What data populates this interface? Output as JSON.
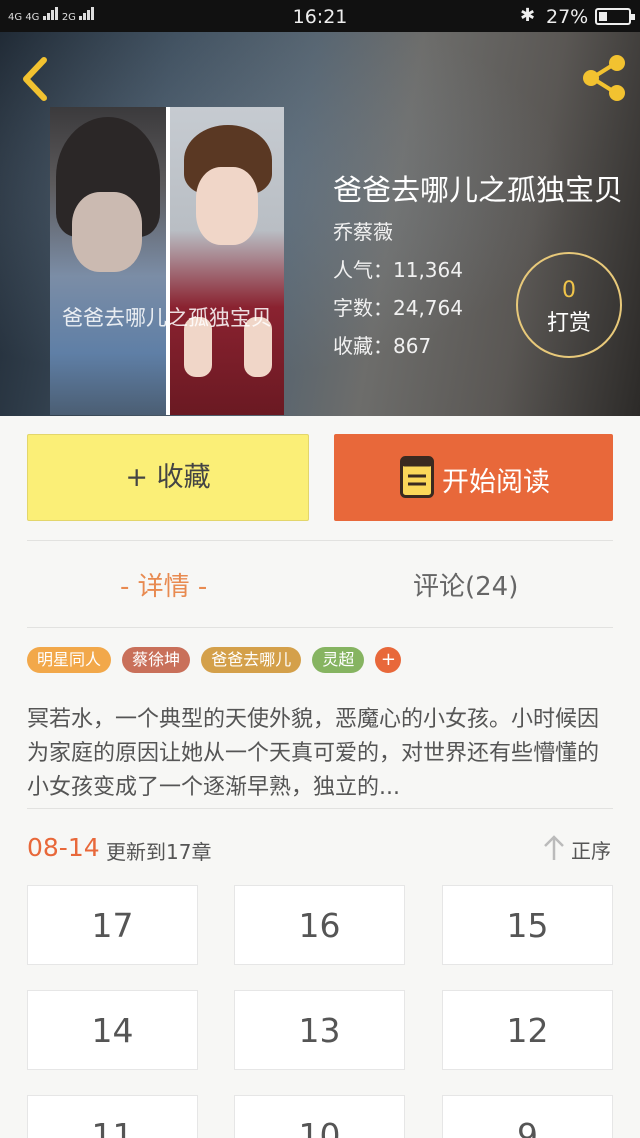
{
  "status_bar": {
    "network_1": "4G",
    "network_2": "4G",
    "network_3": "2G",
    "time": "16:21",
    "bluetooth": "✱",
    "battery": "27%"
  },
  "header": {
    "back_icon": "chevron-left-icon",
    "share_icon": "share-icon",
    "accent": "#f2c230"
  },
  "book": {
    "title": "爸爸去哪儿之孤独宝贝",
    "cover_text": "爸爸去哪儿之孤独宝贝",
    "author": "乔蔡薇",
    "popularity": "人气：11,364",
    "word_count": "字数：24,764",
    "favorites": "收藏：867"
  },
  "tip": {
    "count": "0",
    "label": "打赏"
  },
  "actions": {
    "favorite_label": "+ 收藏",
    "read_label": "开始阅读",
    "read_icon": "book-icon",
    "favorite_color": "#fbef77",
    "read_color": "#e8683a"
  },
  "tabs": {
    "detail": "- 详情 -",
    "comments": "评论(24)"
  },
  "tags": [
    {
      "label": "明星同人",
      "color": "#f2a84a"
    },
    {
      "label": "蔡徐坤",
      "color": "#c9705a"
    },
    {
      "label": "爸爸去哪儿",
      "color": "#d4a04a"
    },
    {
      "label": "灵超",
      "color": "#86b461"
    },
    {
      "label": "+",
      "color": "#e8683a"
    }
  ],
  "summary": "冥若水，一个典型的天使外貌，恶魔心的小女孩。小时候因为家庭的原因让她从一个天真可爱的，对世界还有些懵懂的小女孩变成了一个逐渐早熟，独立的...",
  "updates": {
    "date": "08-14",
    "text": "更新到17章",
    "sort_label": "正序",
    "sort_icon": "arrow-up-icon"
  },
  "chapters": [
    "17",
    "16",
    "15",
    "14",
    "13",
    "12",
    "11",
    "10",
    "9"
  ]
}
